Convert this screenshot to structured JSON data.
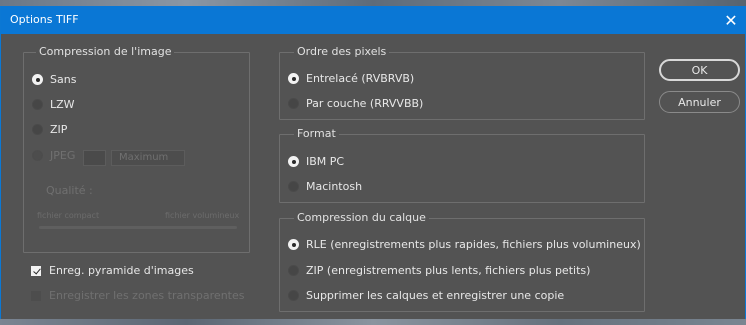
{
  "window": {
    "title": "Options TIFF",
    "close_glyph": "✕"
  },
  "buttons": {
    "ok": "OK",
    "cancel": "Annuler"
  },
  "image_compression": {
    "legend": "Compression de l'image",
    "options": [
      {
        "label": "Sans",
        "selected": true,
        "enabled": true
      },
      {
        "label": "LZW",
        "selected": false,
        "enabled": true
      },
      {
        "label": "ZIP",
        "selected": false,
        "enabled": true
      },
      {
        "label": "JPEG",
        "selected": false,
        "enabled": false
      }
    ],
    "quality_label": "Qualité :",
    "quality_value": "",
    "quality_select": "Maximum",
    "small_file": "fichier compact",
    "large_file": "fichier volumineux"
  },
  "pixel_order": {
    "legend": "Ordre des pixels",
    "options": [
      {
        "label": "Entrelacé (RVBRVB)",
        "selected": true
      },
      {
        "label": "Par couche (RRVVBB)",
        "selected": false
      }
    ]
  },
  "format": {
    "legend": "Format",
    "options": [
      {
        "label": "IBM PC",
        "selected": true
      },
      {
        "label": "Macintosh",
        "selected": false
      }
    ]
  },
  "layer_compression": {
    "legend": "Compression du calque",
    "options": [
      {
        "label": "RLE (enregistrements plus rapides, fichiers plus volumineux)",
        "selected": true
      },
      {
        "label": "ZIP (enregistrements plus lents, fichiers plus petits)",
        "selected": false
      },
      {
        "label": "Supprimer les calques et enregistrer une copie",
        "selected": false
      }
    ]
  },
  "checkboxes": {
    "pyramid": {
      "label": "Enreg. pyramide d'images",
      "checked": true,
      "enabled": true
    },
    "transparency": {
      "label": "Enregistrer les zones transparentes",
      "checked": false,
      "enabled": false
    }
  },
  "colors": {
    "titlebar": "#0a77d5",
    "dialog_bg": "#535353",
    "border": "#6e6e6e"
  }
}
